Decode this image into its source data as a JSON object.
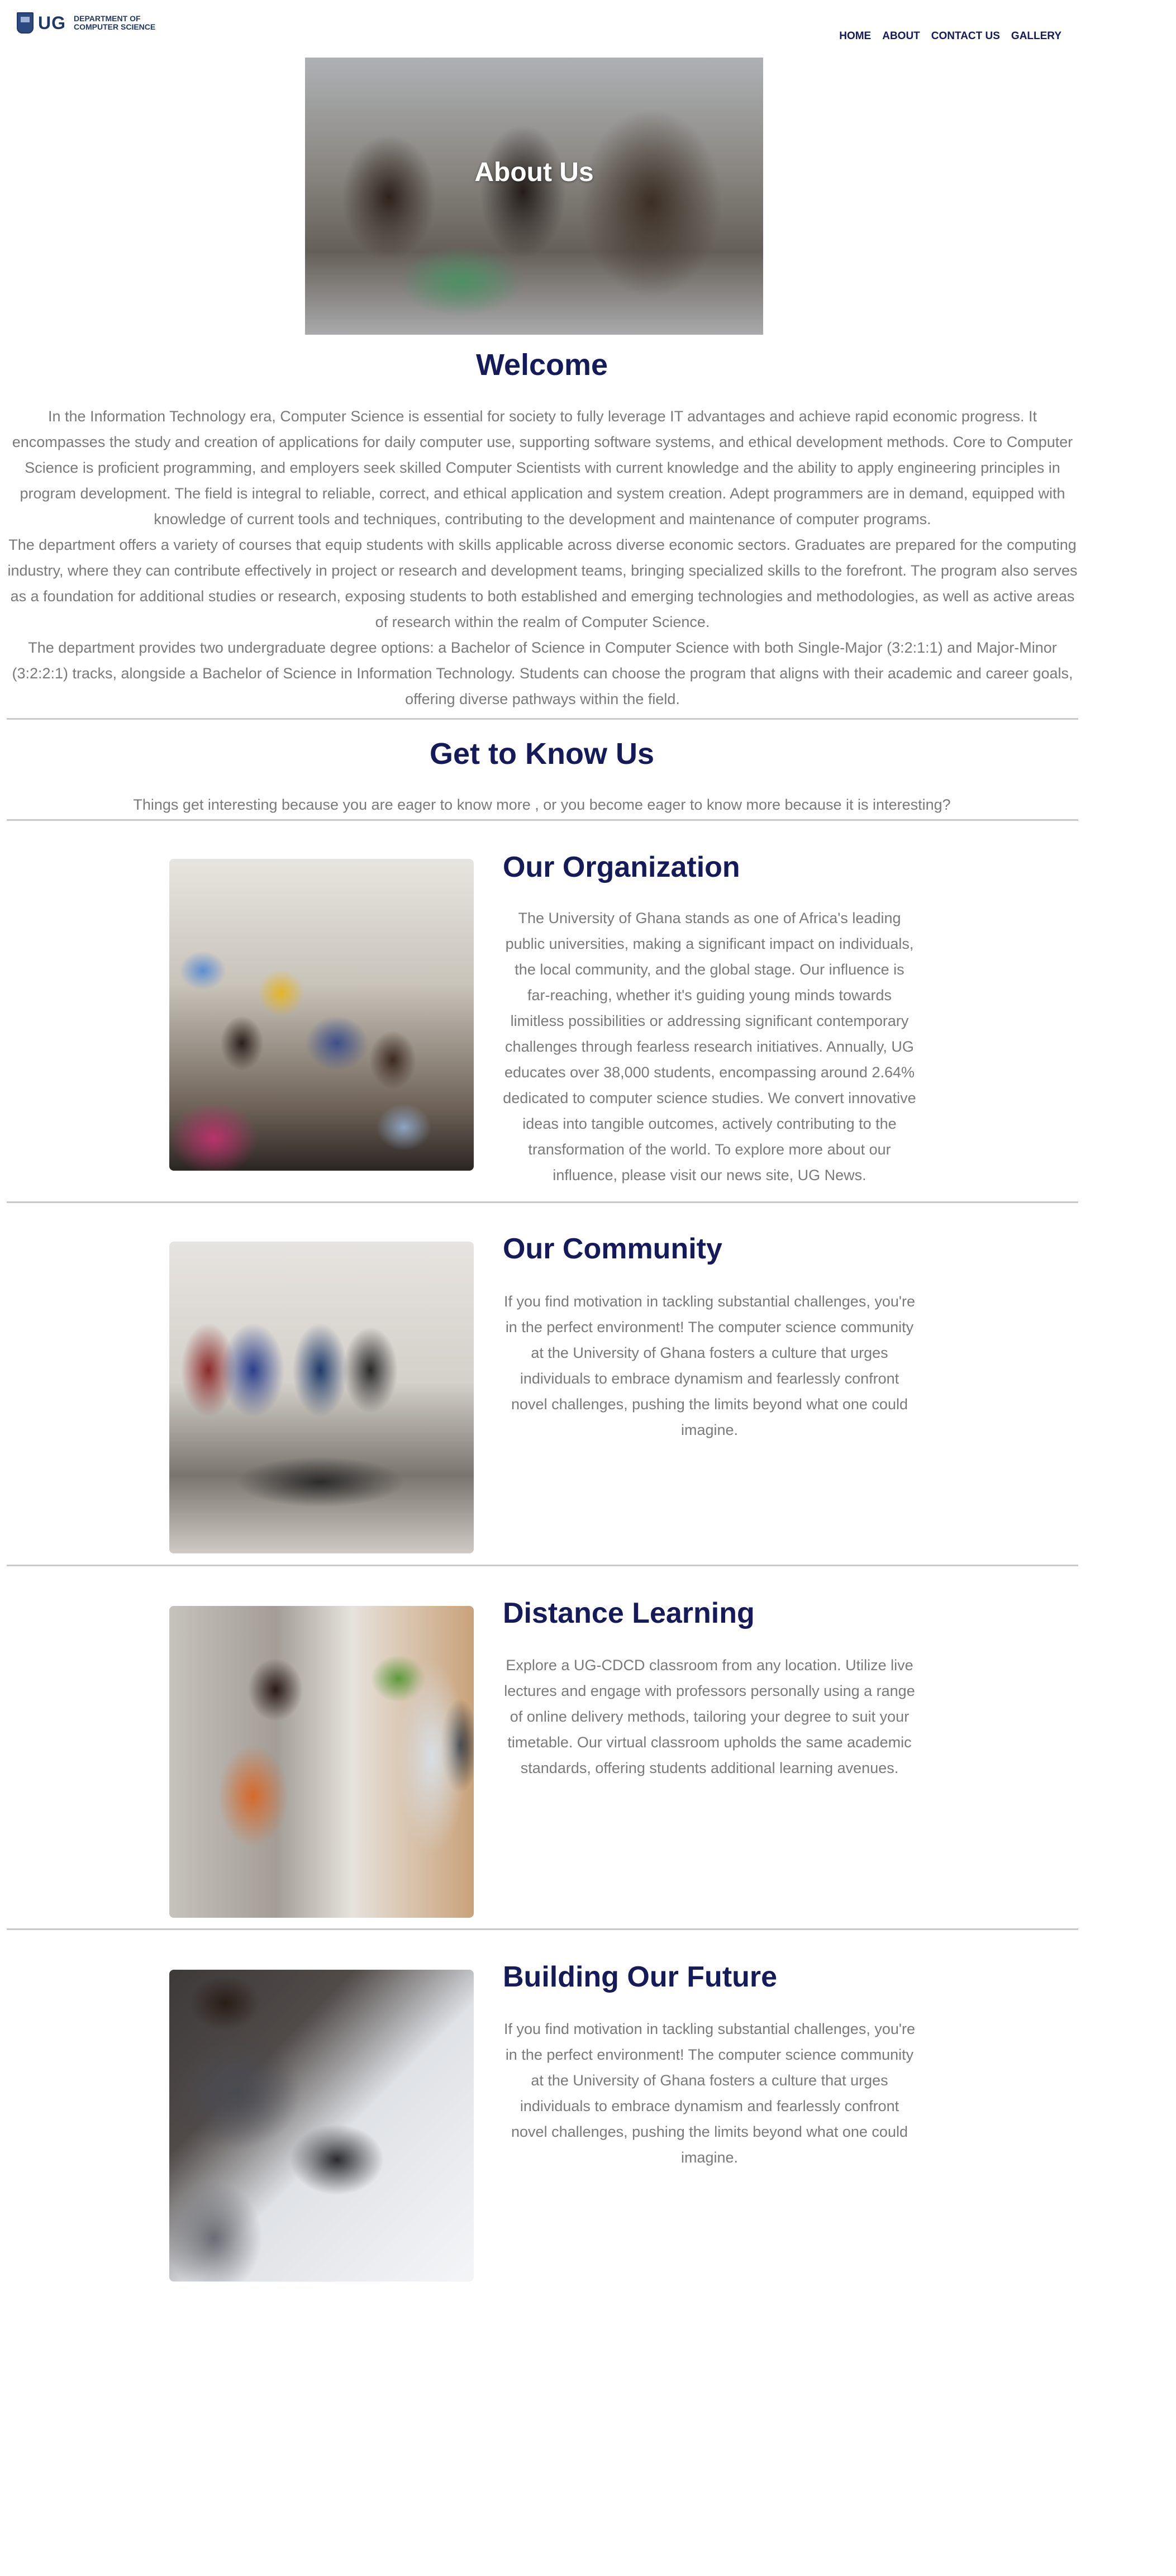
{
  "header": {
    "logo_text": "UG",
    "dept_line1": "DEPARTMENT OF",
    "dept_line2": "COMPUTER SCIENCE",
    "nav": [
      "HOME",
      "ABOUT",
      "CONTACT US",
      "GALLERY"
    ]
  },
  "hero": {
    "title": "About Us"
  },
  "welcome": {
    "title": "Welcome",
    "paragraphs": [
      "In the Information Technology era, Computer Science is essential for society to fully leverage IT advantages and achieve rapid economic progress. It encompasses the study and creation of applications for daily computer use, supporting software systems, and ethical development methods. Core to Computer Science is proficient programming, and employers seek skilled Computer Scientists with current knowledge and the ability to apply engineering principles in program development. The field is integral to reliable, correct, and ethical application and system creation. Adept programmers are in demand, equipped with knowledge of current tools and techniques, contributing to the development and maintenance of computer programs.",
      "The department offers a variety of courses that equip students with skills applicable across diverse economic sectors. Graduates are prepared for the computing industry, where they can contribute effectively in project or research and development teams, bringing specialized skills to the forefront. The program also serves as a foundation for additional studies or research, exposing students to both established and emerging technologies and methodologies, as well as active areas of research within the realm of Computer Science.",
      "The department provides two undergraduate degree options: a Bachelor of Science in Computer Science with both Single-Major (3:2:1:1) and Major-Minor (3:2:2:1) tracks, alongside a Bachelor of Science in Information Technology. Students can choose the program that aligns with their academic and career goals, offering diverse pathways within the field."
    ]
  },
  "know": {
    "title": "Get to Know Us",
    "subtitle": "Things get interesting because you are eager to know more , or you become eager to know more because it is interesting?"
  },
  "sections": [
    {
      "title": "Our Organization",
      "text": "The University of Ghana stands as one of Africa's leading public universities, making a significant impact on individuals, the local community, and the global stage. Our influence is far-reaching, whether it's guiding young minds towards limitless possibilities or addressing significant contemporary challenges through fearless research initiatives. Annually, UG educates over 38,000 students, encompassing around 2.64% dedicated to computer science studies. We convert innovative ideas into tangible outcomes, actively contributing to the transformation of the world. To explore more about our influence, please visit our news site, UG News."
    },
    {
      "title": "Our Community",
      "text": "If you find motivation in tackling substantial challenges, you're in the perfect environment! The computer science community at the University of Ghana fosters a culture that urges individuals to embrace dynamism and fearlessly confront novel challenges, pushing the limits beyond what one could imagine."
    },
    {
      "title": "Distance Learning",
      "text": "Explore a UG-CDCD classroom from any location. Utilize live lectures and engage with professors personally using a range of online delivery methods, tailoring your degree to suit your timetable. Our virtual classroom upholds the same academic standards, offering students additional learning avenues."
    },
    {
      "title": "Building Our Future",
      "text": "If you find motivation in tackling substantial challenges, you're in the perfect environment! The computer science community at the University of Ghana fosters a culture that urges individuals to embrace dynamism and fearlessly confront novel challenges, pushing the limits beyond what one could imagine."
    }
  ]
}
